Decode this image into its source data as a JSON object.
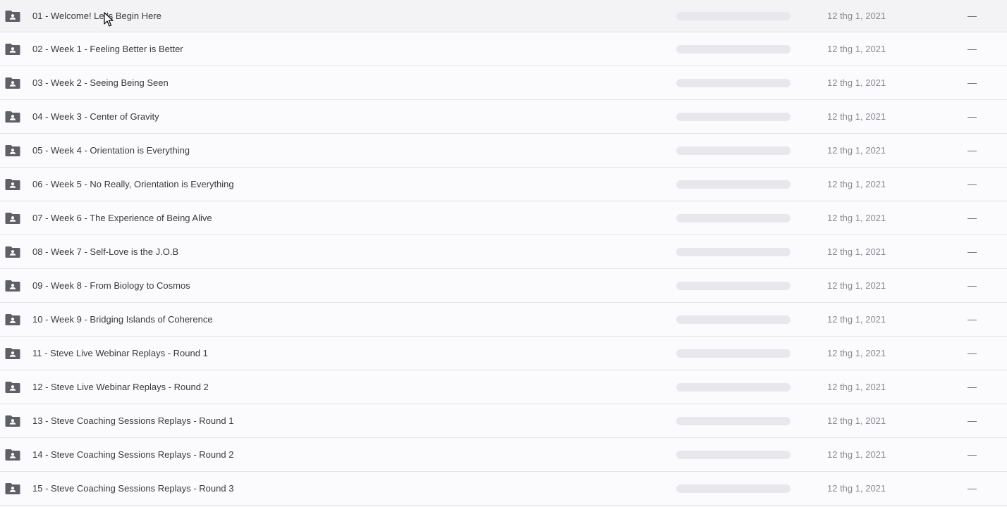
{
  "icons": {
    "folder": "shared-folder-icon",
    "cursor": "mouse-pointer-icon"
  },
  "colors": {
    "folder_icon": "#5f5f66",
    "name_text": "#3a3a3c",
    "muted_text": "#8a8a90",
    "placeholder_bar": "#e8e8ec"
  },
  "files": [
    {
      "name": "01 - Welcome! Let's Begin Here",
      "modified": "12 thg 1, 2021",
      "size": "—"
    },
    {
      "name": "02 - Week 1 - Feeling Better is Better",
      "modified": "12 thg 1, 2021",
      "size": "—"
    },
    {
      "name": "03 - Week 2 - Seeing Being Seen",
      "modified": "12 thg 1, 2021",
      "size": "—"
    },
    {
      "name": "04 - Week 3 - Center of Gravity",
      "modified": "12 thg 1, 2021",
      "size": "—"
    },
    {
      "name": "05 - Week 4 - Orientation is Everything",
      "modified": "12 thg 1, 2021",
      "size": "—"
    },
    {
      "name": "06 - Week 5 - No Really, Orientation is Everything",
      "modified": "12 thg 1, 2021",
      "size": "—"
    },
    {
      "name": "07 - Week 6 - The Experience of Being Alive",
      "modified": "12 thg 1, 2021",
      "size": "—"
    },
    {
      "name": "08 - Week 7 - Self-Love is the J.O.B",
      "modified": "12 thg 1, 2021",
      "size": "—"
    },
    {
      "name": "09 - Week 8 - From Biology to Cosmos",
      "modified": "12 thg 1, 2021",
      "size": "—"
    },
    {
      "name": "10 - Week 9 - Bridging Islands of Coherence",
      "modified": "12 thg 1, 2021",
      "size": "—"
    },
    {
      "name": "11 - Steve Live Webinar Replays - Round 1",
      "modified": "12 thg 1, 2021",
      "size": "—"
    },
    {
      "name": "12 - Steve Live Webinar Replays - Round 2",
      "modified": "12 thg 1, 2021",
      "size": "—"
    },
    {
      "name": "13 - Steve Coaching Sessions Replays - Round 1",
      "modified": "12 thg 1, 2021",
      "size": "—"
    },
    {
      "name": "14 - Steve Coaching Sessions Replays - Round 2",
      "modified": "12 thg 1, 2021",
      "size": "—"
    },
    {
      "name": "15 - Steve Coaching Sessions Replays - Round 3",
      "modified": "12 thg 1, 2021",
      "size": "—"
    }
  ]
}
